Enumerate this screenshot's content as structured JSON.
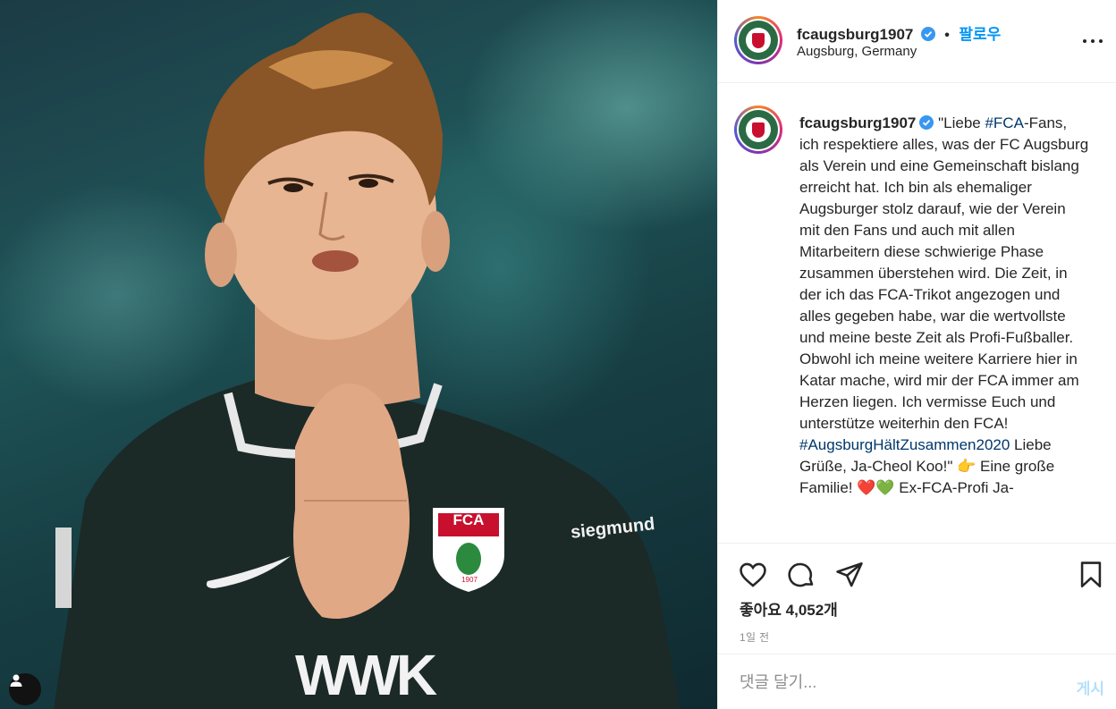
{
  "post": {
    "username": "fcaugsburg1907",
    "separator": "•",
    "follow_label": "팔로우",
    "location": "Augsburg, Germany",
    "photo_description": "Player in dark green FCA jersey applauding",
    "jersey": {
      "badge_text": "FCA",
      "badge_year": "1907",
      "sponsor_sleeve": "siegmund",
      "chest_text": "WWK"
    }
  },
  "caption": {
    "username": "fcaugsburg1907",
    "text_part1": " \"Liebe ",
    "hashtag1": "#FCA",
    "text_part2": "-Fans, ich respektiere alles, was der FC Augsburg als Verein und eine Gemeinschaft bislang erreicht hat. Ich bin als ehemaliger Augsburger stolz darauf, wie der Verein mit den Fans und auch mit allen Mitarbeitern diese schwierige Phase zusammen überstehen wird. Die Zeit, in der ich das FCA-Trikot angezogen und alles gegeben habe, war die wertvollste und meine beste Zeit als Profi-Fußballer. Obwohl ich meine weitere Karriere hier in Katar mache, wird mir der FCA immer am Herzen liegen. Ich vermisse Euch und unterstütze weiterhin den FCA! ",
    "hashtag2": "#AugsburgHältZusammen2020",
    "text_part3": " Liebe Grüße, Ja-Cheol Koo!\" 👉 Eine große Familie! ❤️💚 Ex-FCA-Profi Ja-"
  },
  "actions": {
    "likes_label": "좋아요 4,052개",
    "time_label": "1일 전"
  },
  "comment": {
    "placeholder": "댓글 달기...",
    "post_label": "게시"
  },
  "colors": {
    "accent": "#0095f6",
    "verified": "#3897f0",
    "hashtag": "#00376b",
    "post_disabled": "#b2dffc",
    "heart_red": "#ed4956",
    "heart_green": "#2fb34a"
  }
}
